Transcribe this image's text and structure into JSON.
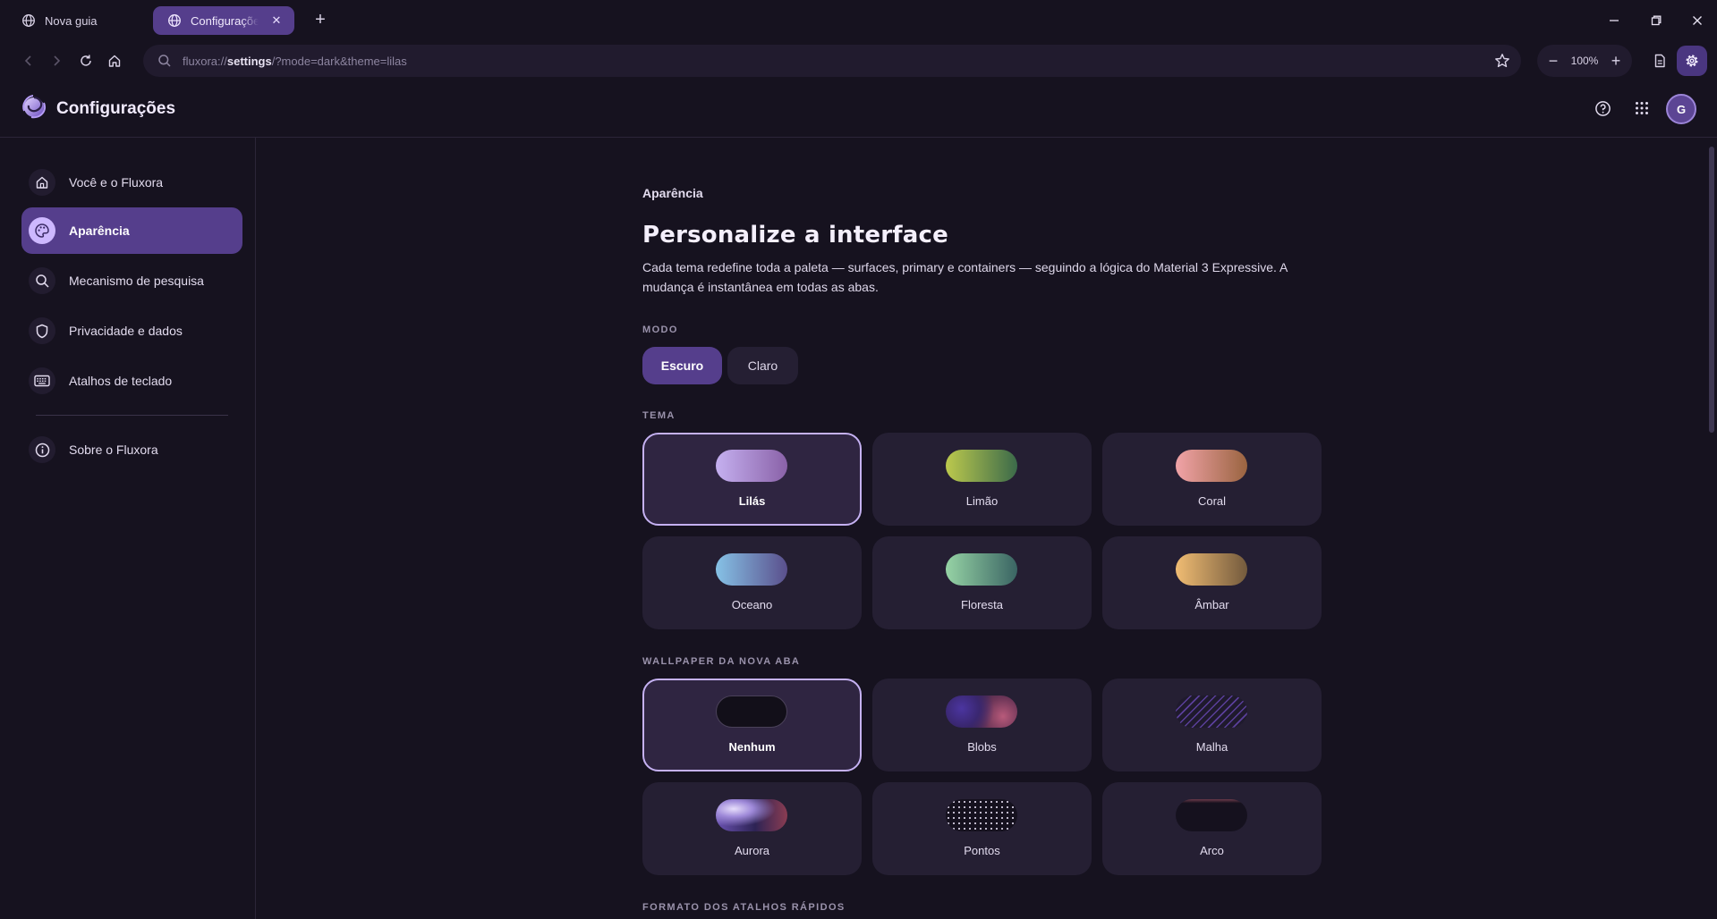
{
  "tabs": [
    {
      "label": "Nova guia"
    },
    {
      "label": "Configurações"
    }
  ],
  "toolbar": {
    "url_scheme": "fluxora://",
    "url_host": "settings",
    "url_rest": "/?mode=dark&theme=lilas",
    "zoom": "100%"
  },
  "header": {
    "title": "Configurações",
    "avatar_initial": "G"
  },
  "sidebar": {
    "items": [
      {
        "label": "Você e o Fluxora",
        "icon": "home-icon"
      },
      {
        "label": "Aparência",
        "icon": "palette-icon",
        "active": true
      },
      {
        "label": "Mecanismo de pesquisa",
        "icon": "search-icon"
      },
      {
        "label": "Privacidade e dados",
        "icon": "shield-icon"
      },
      {
        "label": "Atalhos de teclado",
        "icon": "keyboard-icon"
      },
      {
        "label": "Sobre o Fluxora",
        "icon": "info-icon"
      }
    ]
  },
  "main": {
    "section": "Aparência",
    "heading": "Personalize a interface",
    "description": "Cada tema redefine toda a paleta — surfaces, primary e containers — seguindo a lógica do Material 3 Expressive. A mudança é instantânea em todas as abas.",
    "mode_label": "MODO",
    "modes": [
      "Escuro",
      "Claro"
    ],
    "theme_label": "TEMA",
    "themes": [
      "Lilás",
      "Limão",
      "Coral",
      "Oceano",
      "Floresta",
      "Âmbar"
    ],
    "wallpaper_label": "WALLPAPER DA NOVA ABA",
    "wallpapers": [
      "Nenhum",
      "Blobs",
      "Malha",
      "Aurora",
      "Pontos",
      "Arco"
    ],
    "shortcuts_label": "FORMATO DOS ATALHOS RÁPIDOS"
  },
  "colors": {
    "primary": "#553e8c",
    "primary_container": "#cdb8ff",
    "surface": "#16121f",
    "surface_container": "#251f33",
    "selected_outline": "#c5b1f2"
  }
}
